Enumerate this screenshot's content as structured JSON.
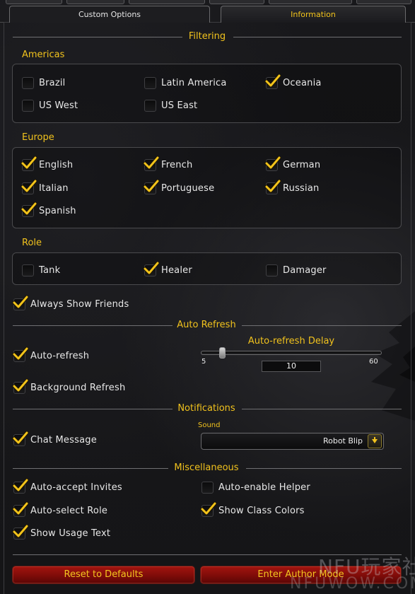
{
  "tabs": {
    "active": "Custom Options",
    "inactive": "Information"
  },
  "sections": {
    "filtering": "Filtering",
    "auto_refresh": "Auto Refresh",
    "notifications": "Notifications",
    "miscellaneous": "Miscellaneous"
  },
  "americas": {
    "label": "Americas",
    "options": [
      {
        "label": "Brazil",
        "checked": false
      },
      {
        "label": "Latin America",
        "checked": false
      },
      {
        "label": "Oceania",
        "checked": true
      },
      {
        "label": "US West",
        "checked": false
      },
      {
        "label": "US East",
        "checked": false
      }
    ]
  },
  "europe": {
    "label": "Europe",
    "options": [
      {
        "label": "English",
        "checked": true
      },
      {
        "label": "French",
        "checked": true
      },
      {
        "label": "German",
        "checked": true
      },
      {
        "label": "Italian",
        "checked": true
      },
      {
        "label": "Portuguese",
        "checked": true
      },
      {
        "label": "Russian",
        "checked": true
      },
      {
        "label": "Spanish",
        "checked": true
      }
    ]
  },
  "role": {
    "label": "Role",
    "options": [
      {
        "label": "Tank",
        "checked": false
      },
      {
        "label": "Healer",
        "checked": true
      },
      {
        "label": "Damager",
        "checked": false
      }
    ]
  },
  "always_show_friends": {
    "label": "Always Show Friends",
    "checked": true
  },
  "auto_refresh": {
    "auto_refresh": {
      "label": "Auto-refresh",
      "checked": true
    },
    "background_refresh": {
      "label": "Background Refresh",
      "checked": true
    },
    "delay": {
      "label": "Auto-refresh Delay",
      "min": "5",
      "max": "60",
      "value": "10",
      "value_num": 10,
      "min_num": 5,
      "max_num": 60
    }
  },
  "notifications": {
    "chat_message": {
      "label": "Chat Message",
      "checked": true
    },
    "sound": {
      "label": "Sound",
      "value": "Robot Blip"
    }
  },
  "misc": {
    "auto_accept": {
      "label": "Auto-accept Invites",
      "checked": true
    },
    "auto_enable_helper": {
      "label": "Auto-enable Helper",
      "checked": false
    },
    "auto_select_role": {
      "label": "Auto-select Role",
      "checked": true
    },
    "show_class_colors": {
      "label": "Show Class Colors",
      "checked": true
    },
    "show_usage_text": {
      "label": "Show Usage Text",
      "checked": true
    }
  },
  "buttons": {
    "reset": "Reset to Defaults",
    "author": "Enter Author Mode"
  },
  "watermark": {
    "logo": "NFU玩家社区",
    "url": "NFUWOW.COM"
  },
  "colors": {
    "accent_gold": "#f1c21d",
    "button_red": "#8e0f0b",
    "check_gold": "#f2c31b"
  }
}
